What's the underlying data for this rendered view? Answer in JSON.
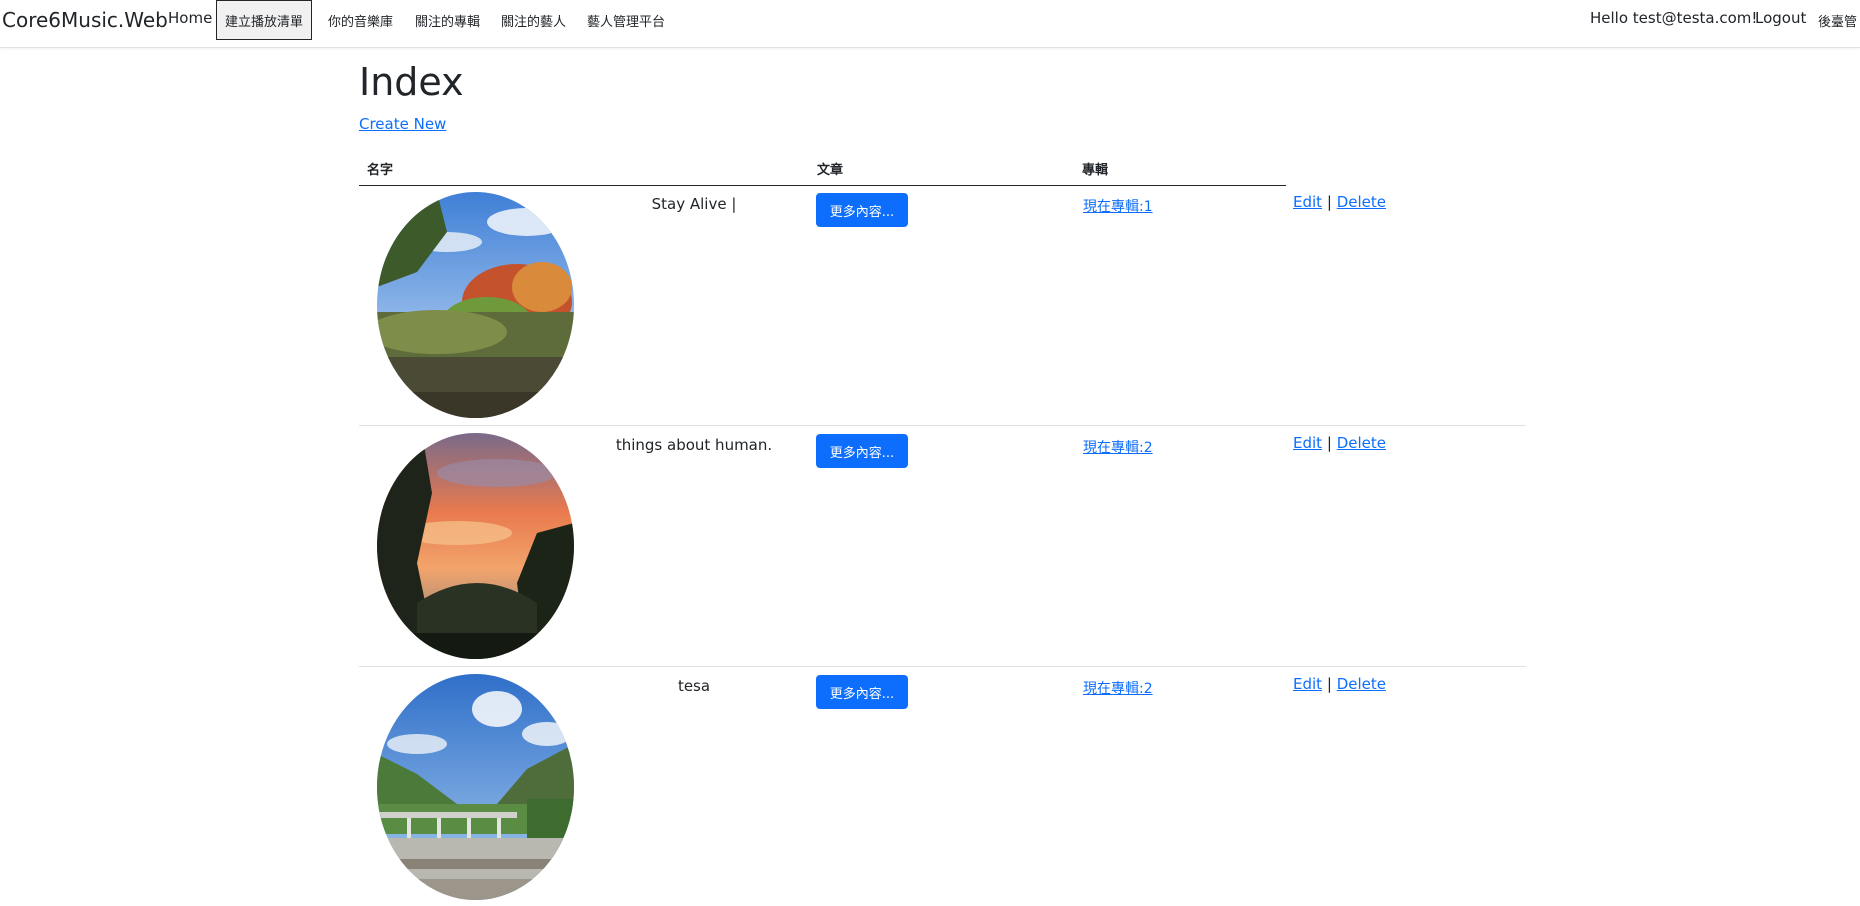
{
  "navbar": {
    "brand": "Core6Music.Web",
    "links": [
      {
        "label": "Home"
      },
      {
        "label": "建立播放清單"
      },
      {
        "label": "你的音樂庫"
      },
      {
        "label": "關注的專輯"
      },
      {
        "label": "關注的藝人"
      },
      {
        "label": "藝人管理平台"
      }
    ],
    "greeting": "Hello test@testa.com!",
    "logout": "Logout",
    "admin": "後臺管"
  },
  "page": {
    "title": "Index",
    "create_new": "Create New"
  },
  "table": {
    "headers": [
      "名字",
      "文章",
      "專輯"
    ],
    "rows": [
      {
        "name": "Stay Alive |",
        "more": "更多內容...",
        "album": "現在專輯:1",
        "edit": "Edit",
        "sep": "|",
        "delete": "Delete",
        "photo": "forest-moss-icon"
      },
      {
        "name": "things about human.",
        "more": "更多內容...",
        "album": "現在專輯:2",
        "edit": "Edit",
        "sep": "|",
        "delete": "Delete",
        "photo": "sunset-trees-icon"
      },
      {
        "name": "tesa",
        "more": "更多內容...",
        "album": "現在專輯:2",
        "edit": "Edit",
        "sep": "|",
        "delete": "Delete",
        "photo": "mountain-bridge-icon"
      }
    ]
  },
  "colors": {
    "link": "#0d6efd",
    "button_bg": "#0d6efd",
    "text": "#212529"
  }
}
